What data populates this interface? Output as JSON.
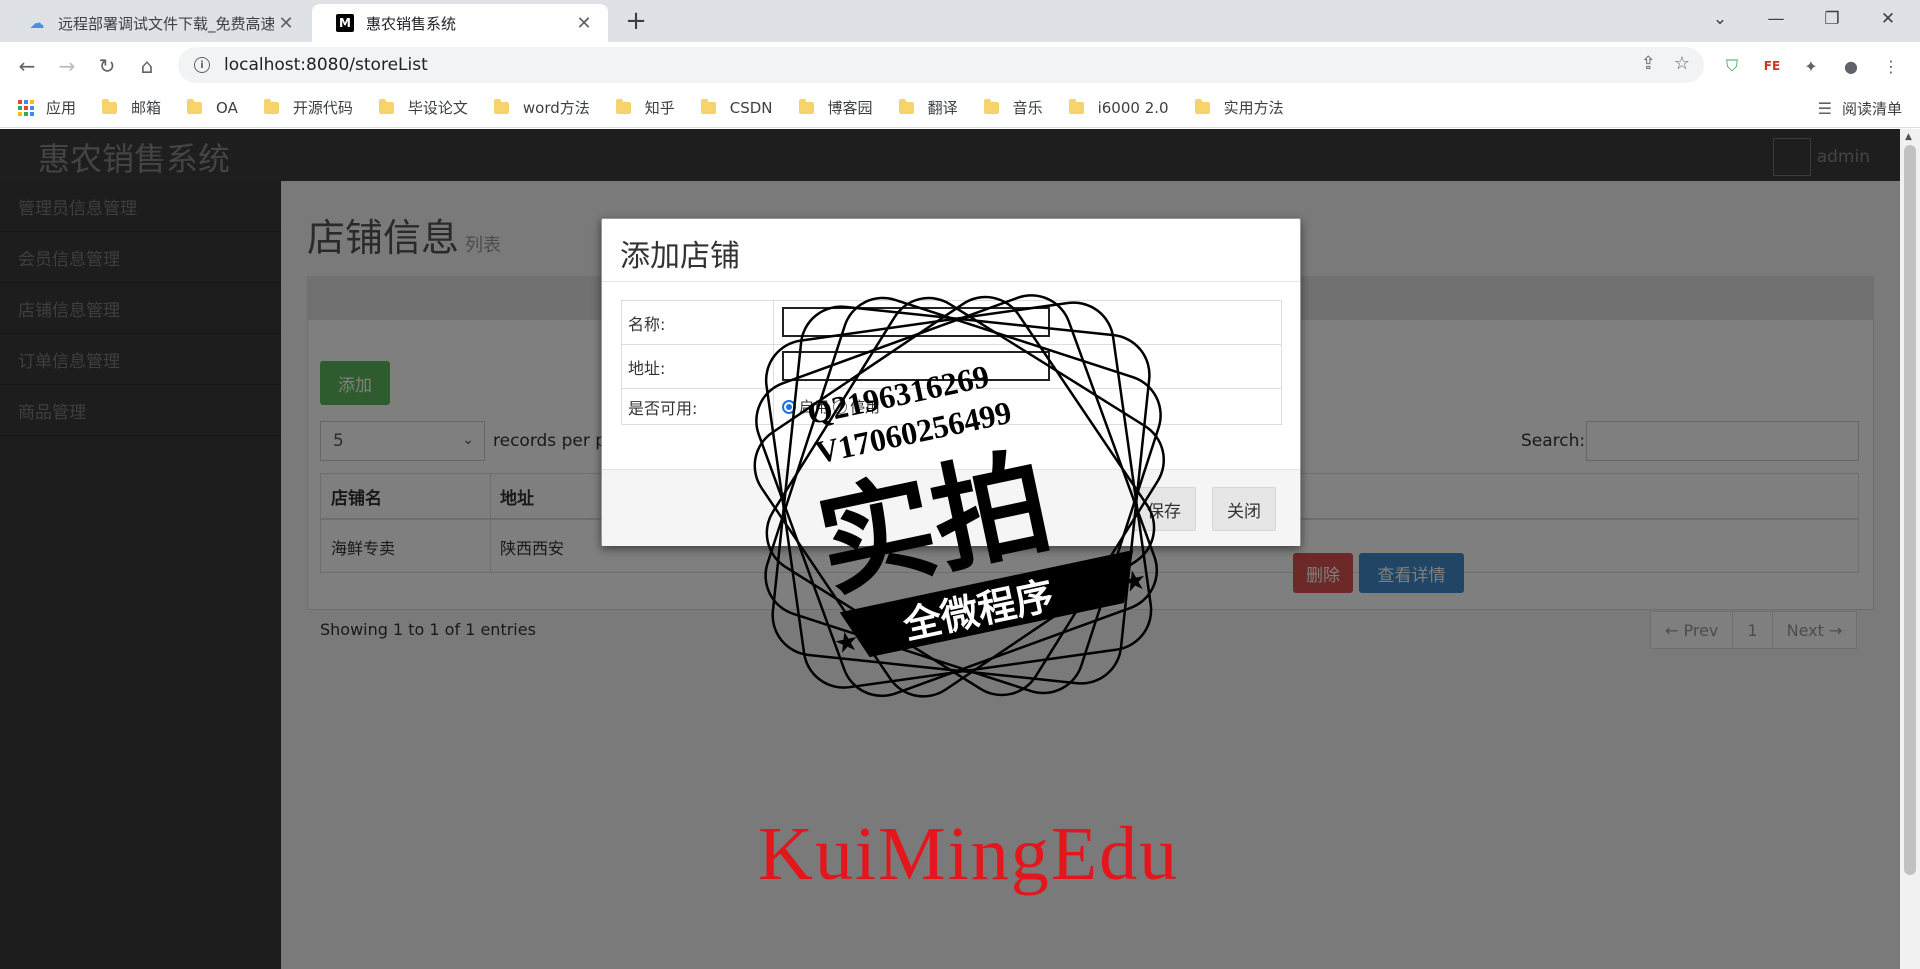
{
  "browser": {
    "tabs": [
      {
        "title": "远程部署调试文件下载_免费高速",
        "active": false
      },
      {
        "title": "惠农销售系统",
        "active": true
      }
    ],
    "url": "localhost:8080/storeList",
    "bookmarks": [
      "应用",
      "邮箱",
      "OA",
      "开源代码",
      "毕设论文",
      "word方法",
      "知乎",
      "CSDN",
      "博客园",
      "翻译",
      "音乐",
      "i6000 2.0",
      "实用方法"
    ],
    "reading_list": "阅读清单"
  },
  "app": {
    "brand": "惠农销售系统",
    "user": "admin",
    "sidebar": [
      "管理员信息管理",
      "会员信息管理",
      "店铺信息管理",
      "订单信息管理",
      "商品管理"
    ],
    "page_title": "店铺信息",
    "page_subtitle": "列表",
    "add_button": "添加",
    "page_length": "5",
    "records_per_page": "records per page",
    "search_label": "Search:",
    "table": {
      "columns": [
        "店铺名",
        "地址"
      ],
      "rows": [
        {
          "name": "海鲜专卖",
          "address": "陕西西安"
        }
      ],
      "delete_label": "删除",
      "detail_label": "查看详情"
    },
    "info": "Showing 1 to 1 of 1 entries",
    "pager": {
      "prev": "← Prev",
      "page": "1",
      "next": "Next →"
    }
  },
  "modal": {
    "title": "添加店铺",
    "name_label": "名称:",
    "address_label": "地址:",
    "enabled_label": "是否可用:",
    "enabled_option": "启用",
    "disabled_option": "停用",
    "save": "保存",
    "close": "关闭"
  },
  "watermark": {
    "qq": "Q2196316269",
    "wechat": "V17060256499",
    "big": "实拍",
    "banner": "全微程序",
    "brand": "KuiMingEdu",
    "color": "#e4161b"
  }
}
